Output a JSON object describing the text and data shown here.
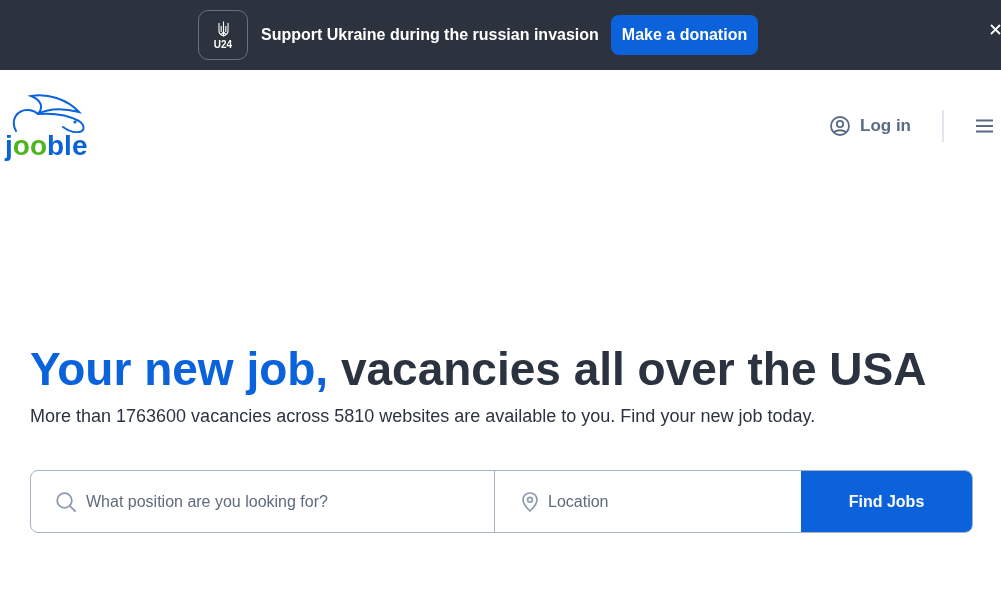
{
  "banner": {
    "badge": "U24",
    "message": "Support Ukraine during the russian invasion",
    "button": "Make a donation"
  },
  "header": {
    "logo": [
      {
        "text": "j",
        "color": "#0b63db"
      },
      {
        "text": "oo",
        "color": "#4db51f"
      },
      {
        "text": "ble",
        "color": "#0b63db"
      }
    ],
    "login": "Log in"
  },
  "hero": {
    "title_highlight": "Your new job,",
    "title_rest": "vacancies all over the USA",
    "subtitle": "More than 1763600 vacancies across 5810 websites are available to you. Find your new job today."
  },
  "search": {
    "position": {
      "placeholder": "What position are you looking for?"
    },
    "location": {
      "placeholder": "Location"
    },
    "button": "Find Jobs"
  }
}
